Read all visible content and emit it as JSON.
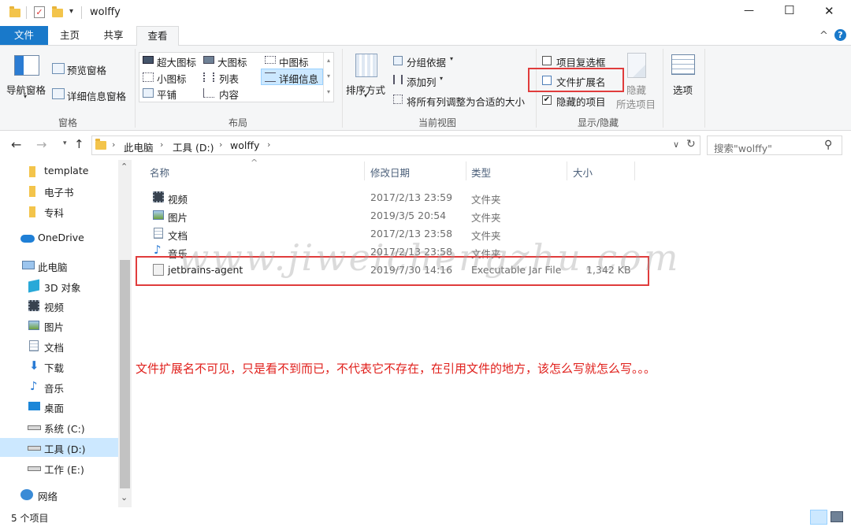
{
  "window": {
    "title": "wolffy",
    "controls": {
      "minimize": "—",
      "maximize": "☐",
      "close": "✕"
    }
  },
  "ribbon": {
    "tabs": [
      "文件",
      "主页",
      "共享",
      "查看"
    ],
    "active_tab": "查看",
    "collapse_glyph": "^",
    "help_glyph": "?",
    "panes_group": {
      "label": "窗格",
      "nav_pane": "导航窗格",
      "preview_pane": "预览窗格",
      "details_pane": "详细信息窗格"
    },
    "layout_group": {
      "label": "布局",
      "items": [
        "超大图标",
        "大图标",
        "中图标",
        "小图标",
        "列表",
        "详细信息",
        "平铺",
        "内容"
      ],
      "selected": "详细信息"
    },
    "current_view_group": {
      "label": "当前视图",
      "sort_by": "排序方式",
      "group_by": "分组依据",
      "add_column": "添加列",
      "fit_columns": "将所有列调整为合适的大小"
    },
    "show_hide_group": {
      "label": "显示/隐藏",
      "item_checkboxes": {
        "label": "项目复选框",
        "checked": false
      },
      "file_extensions": {
        "label": "文件扩展名",
        "checked": false
      },
      "hidden_items": {
        "label": "隐藏的项目",
        "checked": true
      },
      "hide_selected": "隐藏",
      "hide_selected_line2": "所选项目"
    },
    "options": "选项"
  },
  "address_bar": {
    "path": [
      "此电脑",
      "工具 (D:)",
      "wolffy"
    ],
    "search_placeholder": "搜索\"wolffy\""
  },
  "nav_pane": {
    "items": [
      {
        "label": "template",
        "icon": "folder-icon"
      },
      {
        "label": "电子书",
        "icon": "folder-icon"
      },
      {
        "label": "专科",
        "icon": "folder-icon"
      },
      {
        "label": "OneDrive",
        "icon": "cloud-icon"
      },
      {
        "label": "此电脑",
        "icon": "computer-icon"
      },
      {
        "label": "3D 对象",
        "icon": "cube-icon"
      },
      {
        "label": "视频",
        "icon": "video-icon"
      },
      {
        "label": "图片",
        "icon": "picture-icon"
      },
      {
        "label": "文档",
        "icon": "document-icon"
      },
      {
        "label": "下载",
        "icon": "download-icon"
      },
      {
        "label": "音乐",
        "icon": "music-icon"
      },
      {
        "label": "桌面",
        "icon": "desktop-icon"
      },
      {
        "label": "系统 (C:)",
        "icon": "drive-icon"
      },
      {
        "label": "工具 (D:)",
        "icon": "drive-icon",
        "selected": true
      },
      {
        "label": "工作 (E:)",
        "icon": "drive-icon"
      },
      {
        "label": "网络",
        "icon": "network-icon"
      }
    ]
  },
  "file_list": {
    "columns": [
      "名称",
      "修改日期",
      "类型",
      "大小"
    ],
    "rows": [
      {
        "name": "视频",
        "modified": "2017/2/13 23:59",
        "type": "文件夹",
        "size": "",
        "icon": "video-icon"
      },
      {
        "name": "图片",
        "modified": "2019/3/5 20:54",
        "type": "文件夹",
        "size": "",
        "icon": "picture-icon"
      },
      {
        "name": "文档",
        "modified": "2017/2/13 23:58",
        "type": "文件夹",
        "size": "",
        "icon": "document-icon"
      },
      {
        "name": "音乐",
        "modified": "2017/2/13 23:58",
        "type": "文件夹",
        "size": "",
        "icon": "music-icon"
      },
      {
        "name": "jetbrains-agent",
        "modified": "2019/7/30 14:16",
        "type": "Executable Jar File",
        "size": "1,342 KB",
        "icon": "jar-icon"
      }
    ]
  },
  "annotation": "文件扩展名不可见，只是看不到而已，不代表它不存在，在引用文件的地方，该怎么写就怎么写。。。",
  "watermark": "www.jiweichengzhu.com",
  "status_bar": {
    "item_count": "5 个项目"
  },
  "colors": {
    "accent": "#1979ca",
    "highlight_box": "#e03c3c",
    "annotation_text": "#e0201c",
    "selected_nav": "#cce8ff"
  }
}
